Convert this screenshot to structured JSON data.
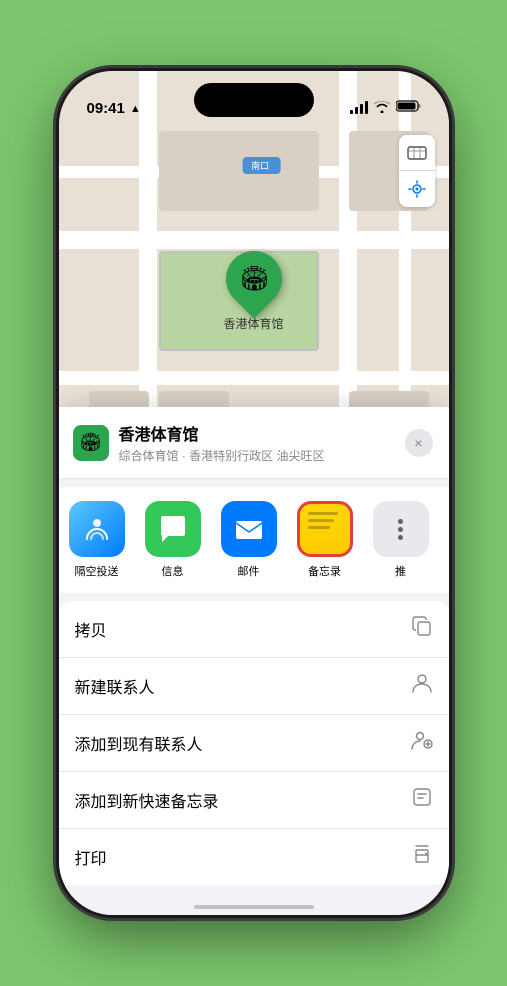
{
  "status_bar": {
    "time": "09:41",
    "location_arrow": "▲"
  },
  "map": {
    "location_label": "南口",
    "venue_marker_emoji": "🏟",
    "venue_marker_name": "香港体育馆"
  },
  "map_controls": {
    "map_icon": "🗺",
    "location_icon": "➤"
  },
  "venue_header": {
    "icon": "🏟",
    "title": "香港体育馆",
    "subtitle": "综合体育馆 · 香港特别行政区 油尖旺区",
    "close_label": "×"
  },
  "share_actions": [
    {
      "id": "airdrop",
      "label": "隔空投送",
      "type": "airdrop"
    },
    {
      "id": "messages",
      "label": "信息",
      "type": "messages"
    },
    {
      "id": "mail",
      "label": "邮件",
      "type": "mail"
    },
    {
      "id": "notes",
      "label": "备忘录",
      "type": "notes"
    },
    {
      "id": "more",
      "label": "推",
      "type": "more"
    }
  ],
  "menu_items": [
    {
      "label": "拷贝",
      "icon": "copy"
    },
    {
      "label": "新建联系人",
      "icon": "person"
    },
    {
      "label": "添加到现有联系人",
      "icon": "person-add"
    },
    {
      "label": "添加到新快速备忘录",
      "icon": "note"
    },
    {
      "label": "打印",
      "icon": "print"
    }
  ]
}
